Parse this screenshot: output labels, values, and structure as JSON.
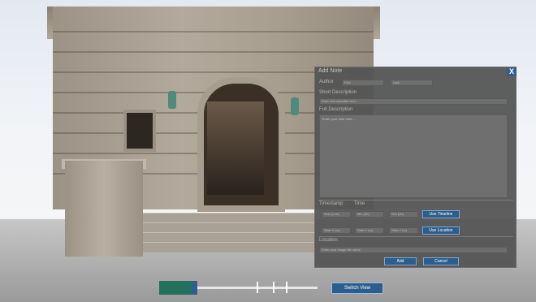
{
  "note_panel": {
    "title": "Add Note",
    "close_label": "X",
    "author_label": "Author",
    "first_name_placeholder": "First",
    "last_name_placeholder": "Last",
    "short_description_label": "Short Description",
    "short_description_placeholder": "Enter text describe here...",
    "full_description_label": "Full Description",
    "full_description_placeholder": "Enter your note here...",
    "timestamp_label": "Timestamp",
    "time_label": "Time",
    "time_fields": [
      "Year (h:m)",
      "Min (hh)",
      "Sec (hh)"
    ],
    "use_timeline_label": "Use Timeline",
    "position_fields": [
      "Start X (m)",
      "Start Y (m)",
      "Start Z (m)"
    ],
    "use_location_label": "Use Location",
    "location_label": "Location",
    "location_placeholder": "Enter your image file name",
    "add_label": "Add",
    "cancel_label": "Cancel"
  },
  "timeline": {
    "switch_view_label": "Switch View",
    "position_fraction": 0.2
  },
  "colors": {
    "accent_blue": "#2b5e8c",
    "panel_bg": "#545454",
    "timeline_green": "#23715c"
  }
}
